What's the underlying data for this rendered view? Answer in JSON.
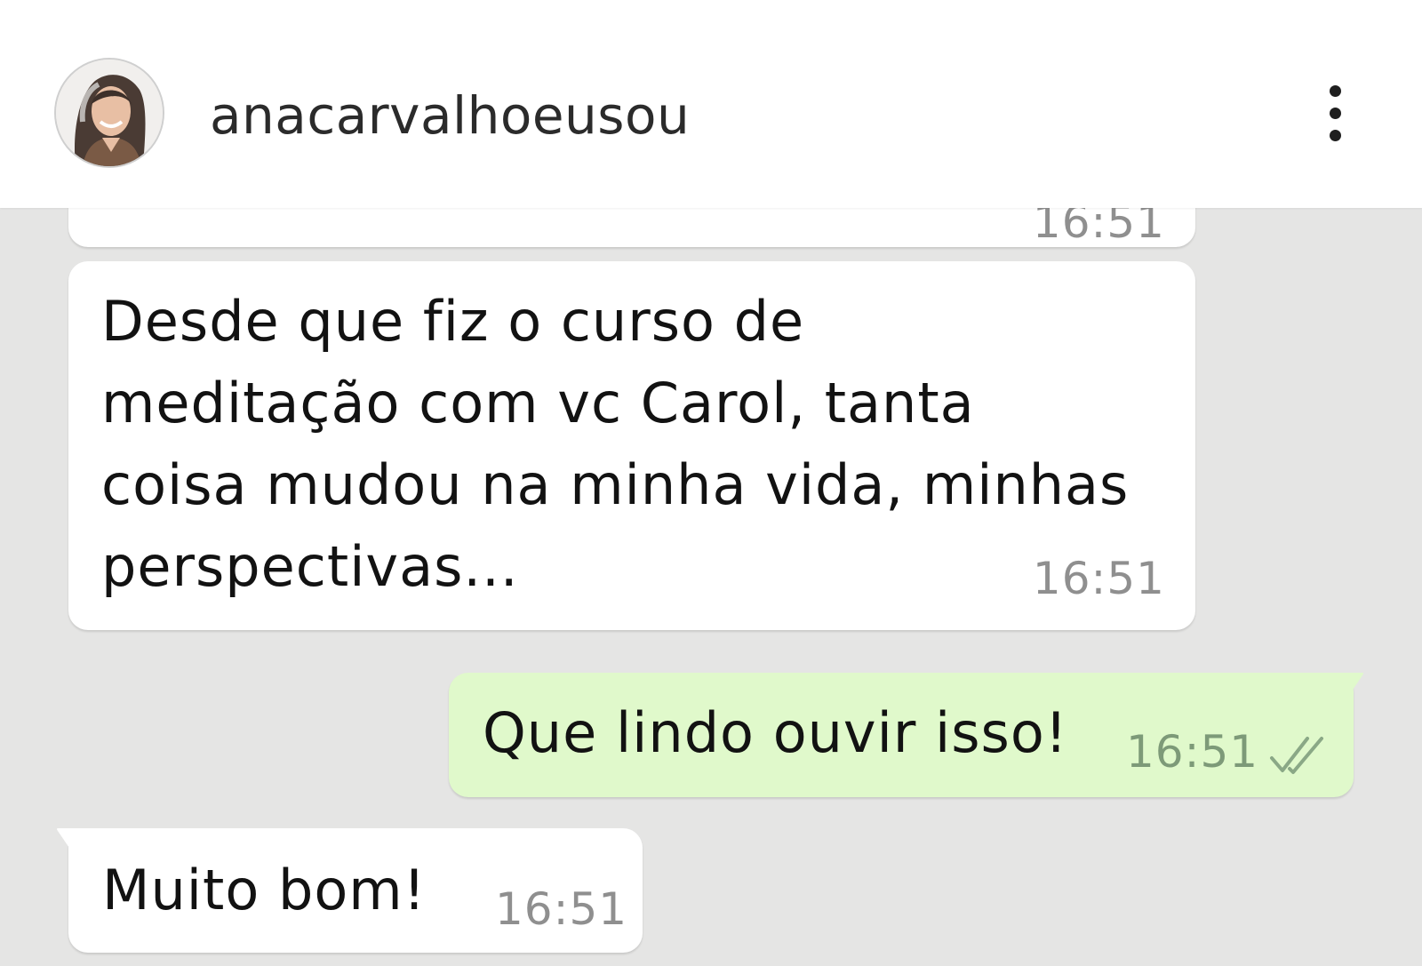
{
  "header": {
    "username": "anacarvalhoeusou",
    "avatar_icon": "profile-photo-avatar",
    "menu_icon": "kebab-menu-icon"
  },
  "messages": [
    {
      "id": "prev",
      "direction": "received",
      "text": "",
      "time": "16:51",
      "partially_visible": true
    },
    {
      "id": "long",
      "direction": "received",
      "text": "Desde que fiz o curso de\nmeditação com vc Carol, tanta\ncoisa mudou na minha vida, minhas\nperspectivas...",
      "time": "16:51"
    },
    {
      "id": "sent",
      "direction": "sent",
      "text": "Que lindo ouvir isso!",
      "time": "16:51",
      "status_icon": "double-check-icon"
    },
    {
      "id": "muito",
      "direction": "received",
      "text": "Muito bom!",
      "time": "16:51"
    }
  ],
  "colors": {
    "chat_background": "#e5e5e4",
    "received_bubble": "#ffffff",
    "sent_bubble": "#e0f9cb",
    "time_received": "#8f8f8f",
    "time_sent": "#7d9a78"
  }
}
